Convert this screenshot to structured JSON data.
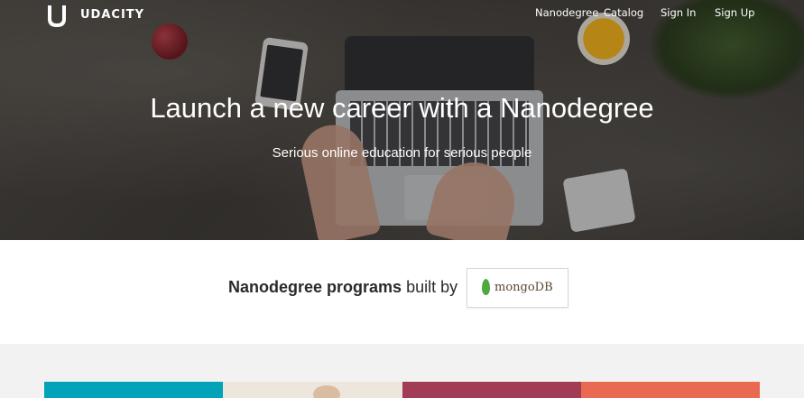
{
  "brand": {
    "name": "UDACITY",
    "logo_icon": "udacity-u-icon"
  },
  "nav": {
    "items": [
      {
        "label": "Nanodegree"
      },
      {
        "label": "Catalog"
      },
      {
        "label": "Sign In"
      },
      {
        "label": "Sign Up"
      }
    ]
  },
  "hero": {
    "title": "Launch a new career with a Nanodegree",
    "subtitle": "Serious online education for serious people"
  },
  "partner": {
    "bold": "Nanodegree programs",
    "rest": " built by",
    "logo_text": "mongoDB",
    "logo_icon": "mongodb-leaf-icon"
  },
  "colors": {
    "card_teal": "#02a2b8",
    "card_cream": "#ede6dd",
    "card_maroon": "#a23b55",
    "card_coral": "#e86a52",
    "bottom_bg": "#f2f2f2"
  }
}
